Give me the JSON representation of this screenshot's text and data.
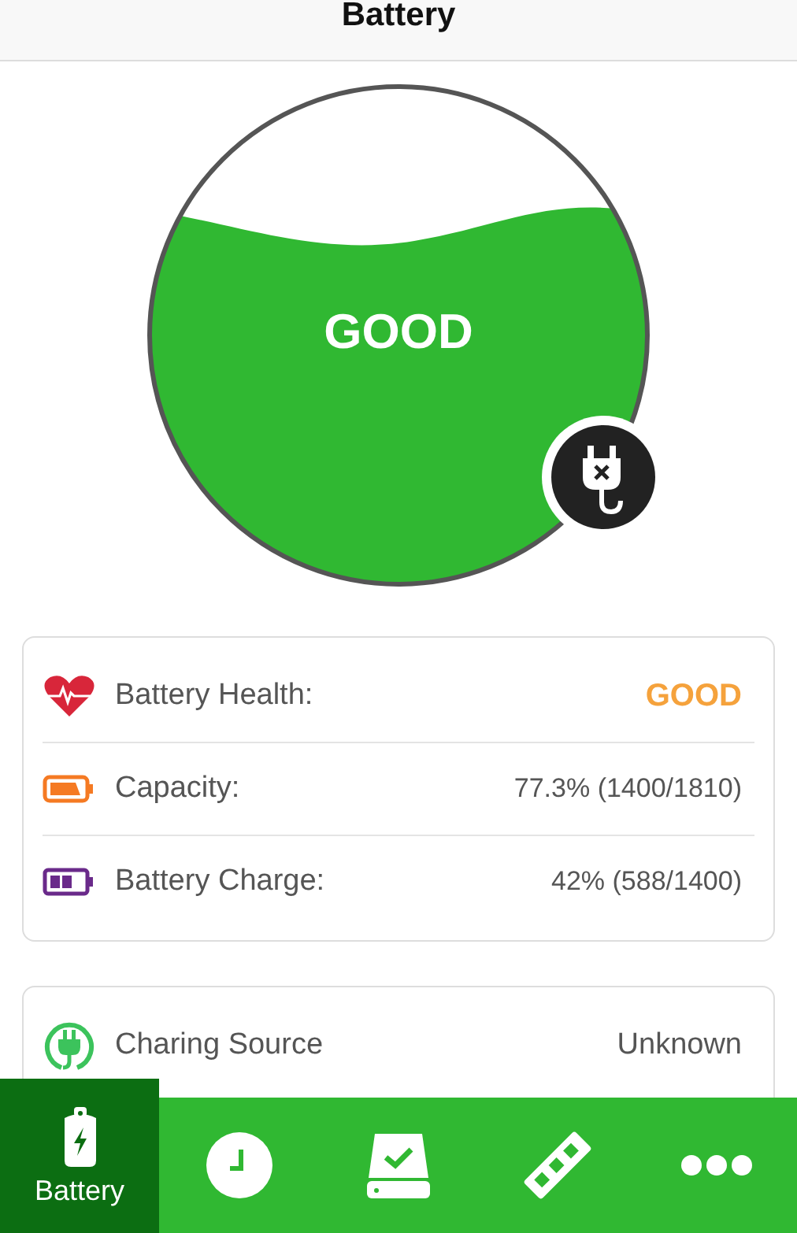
{
  "header": {
    "title": "Battery"
  },
  "gauge": {
    "status": "GOOD",
    "plugged": false
  },
  "details": [
    {
      "kind": "health",
      "label": "Battery Health:",
      "value": "GOOD"
    },
    {
      "kind": "capacity",
      "label": "Capacity:",
      "value": "77.3% (1400/1810)"
    },
    {
      "kind": "charge",
      "label": "Battery Charge:",
      "value": "42% (588/1400)"
    }
  ],
  "source": {
    "label": "Charing Source",
    "value": "Unknown"
  },
  "tabs": [
    {
      "kind": "battery",
      "label": "Battery",
      "selected": true
    },
    {
      "kind": "clock",
      "selected": false
    },
    {
      "kind": "drive",
      "selected": false
    },
    {
      "kind": "memory",
      "selected": false
    },
    {
      "kind": "more",
      "selected": false
    }
  ]
}
